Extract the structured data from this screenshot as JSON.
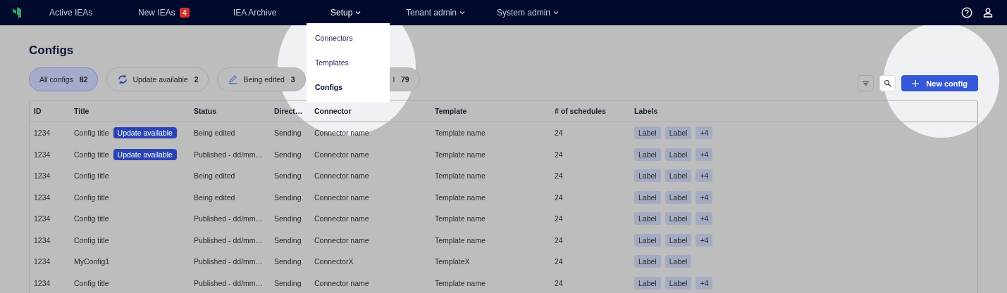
{
  "nav": {
    "items": [
      {
        "label": "Active IEAs",
        "selected": false,
        "dropdown": false
      },
      {
        "label": "New IEAs",
        "badge": "4",
        "selected": false,
        "dropdown": false
      },
      {
        "label": "IEA Archive",
        "selected": false,
        "dropdown": false
      },
      {
        "label": "Setup",
        "selected": true,
        "dropdown": true
      },
      {
        "label": "Tenant admin",
        "selected": false,
        "dropdown": true
      },
      {
        "label": "System admin",
        "selected": false,
        "dropdown": true
      }
    ]
  },
  "setup_menu": {
    "items": [
      {
        "label": "Connectors",
        "selected": false
      },
      {
        "label": "Templates",
        "selected": false
      },
      {
        "label": "Configs",
        "selected": true
      }
    ]
  },
  "page_title": "Configs",
  "filters": [
    {
      "kind": "plain",
      "label": "All configs",
      "count": "82",
      "selected": true
    },
    {
      "kind": "update",
      "label": "Update available",
      "count": "2",
      "selected": false
    },
    {
      "kind": "edit",
      "label": "Being edited",
      "count": "3",
      "selected": false
    },
    {
      "kind": "partial",
      "label": "l",
      "count": "79",
      "selected": false
    }
  ],
  "new_config_button": "New config",
  "table": {
    "columns": [
      "ID",
      "Title",
      "Status",
      "Direct…",
      "Connector",
      "Template",
      "# of schedules",
      "Labels"
    ],
    "rows": [
      {
        "id": "1234",
        "title": "Config title",
        "badge": "Update available",
        "status": "Being edited",
        "direction": "Sending",
        "connector": "Connector name",
        "template": "Template name",
        "schedules": "24",
        "labels": [
          "Label",
          "Label",
          "+4"
        ]
      },
      {
        "id": "1234",
        "title": "Config title",
        "badge": "Update available",
        "status": "Published - dd/mm…",
        "direction": "Sending",
        "connector": "Connector name",
        "template": "Template name",
        "schedules": "24",
        "labels": [
          "Label",
          "Label",
          "+4"
        ]
      },
      {
        "id": "1234",
        "title": "Config title",
        "status": "Being edited",
        "direction": "Sending",
        "connector": "Connector name",
        "template": "Template name",
        "schedules": "24",
        "labels": [
          "Label",
          "Label",
          "+4"
        ]
      },
      {
        "id": "1234",
        "title": "Config title",
        "status": "Being edited",
        "direction": "Sending",
        "connector": "Connector name",
        "template": "Template name",
        "schedules": "24",
        "labels": [
          "Label",
          "Label",
          "+4"
        ]
      },
      {
        "id": "1234",
        "title": "Config title",
        "status": "Published - dd/mm…",
        "direction": "Sending",
        "connector": "Connector name",
        "template": "Template name",
        "schedules": "24",
        "labels": [
          "Label",
          "Label",
          "+4"
        ]
      },
      {
        "id": "1234",
        "title": "Config title",
        "status": "Published - dd/mm…",
        "direction": "Sending",
        "connector": "Connector name",
        "template": "Template name",
        "schedules": "24",
        "labels": [
          "Label",
          "Label",
          "+4"
        ]
      },
      {
        "id": "1234",
        "title": "MyConfig1",
        "status": "Published - dd/mm…",
        "direction": "Sending",
        "connector": "ConnectorX",
        "template": "TemplateX",
        "schedules": "24",
        "labels": [
          "Label",
          "Label"
        ]
      },
      {
        "id": "1234",
        "title": "Config title",
        "status": "Published - dd/mm…",
        "direction": "Sending",
        "connector": "Connector name",
        "template": "Template name",
        "schedules": "24",
        "labels": [
          "Label",
          "Label",
          "+4"
        ]
      }
    ]
  }
}
